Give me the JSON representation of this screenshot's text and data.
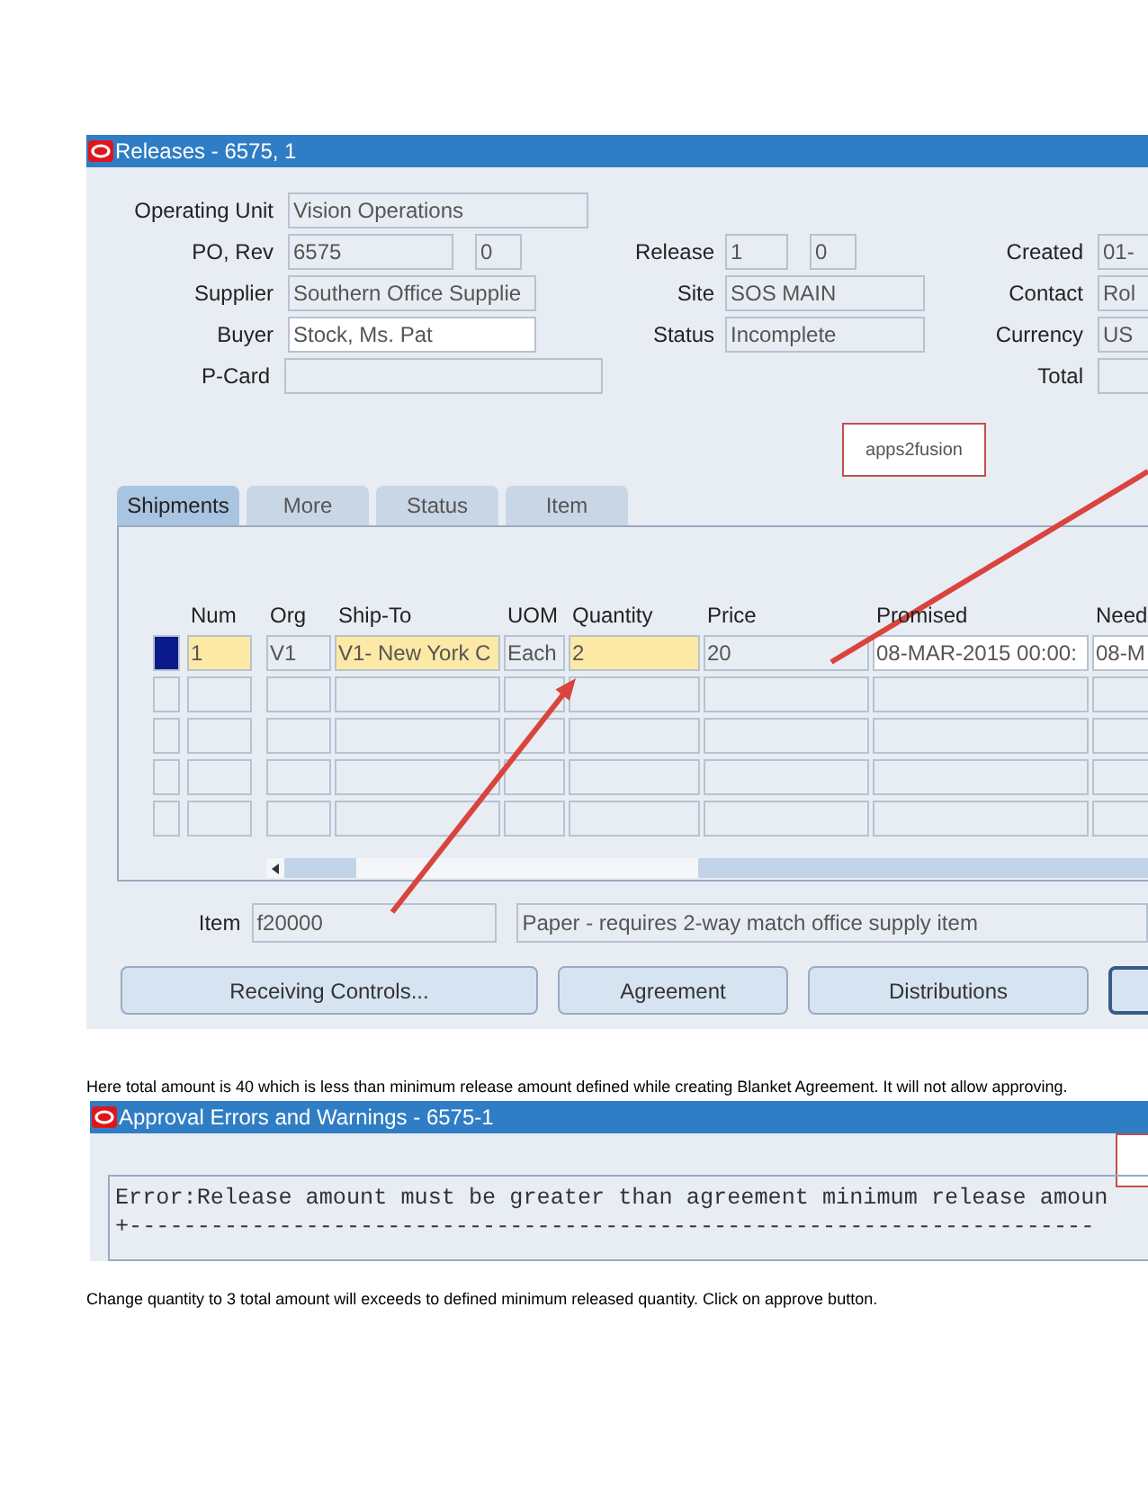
{
  "releases_window": {
    "title": "Releases - 6575, 1",
    "header_fields": [
      {
        "label": "Operating Unit",
        "value": "Vision Operations",
        "editable": false
      },
      {
        "label": "PO, Rev",
        "value": "6575",
        "value_2": "0",
        "editable": false
      },
      {
        "label": "Supplier",
        "value": "Southern Office Supplie",
        "editable": false
      },
      {
        "label": "Buyer",
        "value": "Stock, Ms. Pat",
        "editable": true
      },
      {
        "label": "P-Card",
        "editable": false
      }
    ],
    "middle_fields": [
      {
        "label": "Release",
        "value": "1",
        "value_2": "0"
      },
      {
        "label": "Site",
        "value": "SOS MAIN"
      },
      {
        "label": "Status",
        "value": "Incomplete"
      }
    ],
    "right_fields": [
      {
        "label": "Created",
        "value": "01-"
      },
      {
        "label": "Contact",
        "value": "Rol"
      },
      {
        "label": "Currency",
        "value": "US"
      },
      {
        "label": "Total"
      }
    ],
    "logo": {
      "text": "apps2fusion"
    },
    "tabs": [
      {
        "label": "Shipments",
        "selected": true
      },
      {
        "label": "More",
        "selected": false
      },
      {
        "label": "Status",
        "selected": false
      },
      {
        "label": "Item",
        "selected": false
      }
    ],
    "table": {
      "columns": [
        "Num",
        "Org",
        "Ship-To",
        "UOM",
        "Quantity",
        "Price",
        "Promised",
        "Need"
      ],
      "rows": [
        {
          "selected": true,
          "cells": [
            "1",
            "V1",
            "V1- New York C",
            "Each",
            "2",
            "20",
            "08-MAR-2015 00:00:",
            "08-M"
          ]
        }
      ]
    },
    "item": {
      "label": "Item",
      "value": "f20000",
      "description": "Paper - requires 2-way match office supply item"
    },
    "buttons": [
      "Receiving Controls...",
      "Agreement",
      "Distributions"
    ]
  },
  "note_1": "Here total amount is 40 which is less than minimum release amount defined while creating Blanket Agreement. It will not allow approving.",
  "error_window": {
    "title": "Approval Errors and Warnings - 6575-1",
    "message": "Error:Release amount must be greater than agreement minimum release amoun",
    "separator": "+-----------------------------------------------------------------------"
  },
  "note_2": "Change quantity to 3 total amount will exceeds to defined minimum released quantity. Click on approve button."
}
